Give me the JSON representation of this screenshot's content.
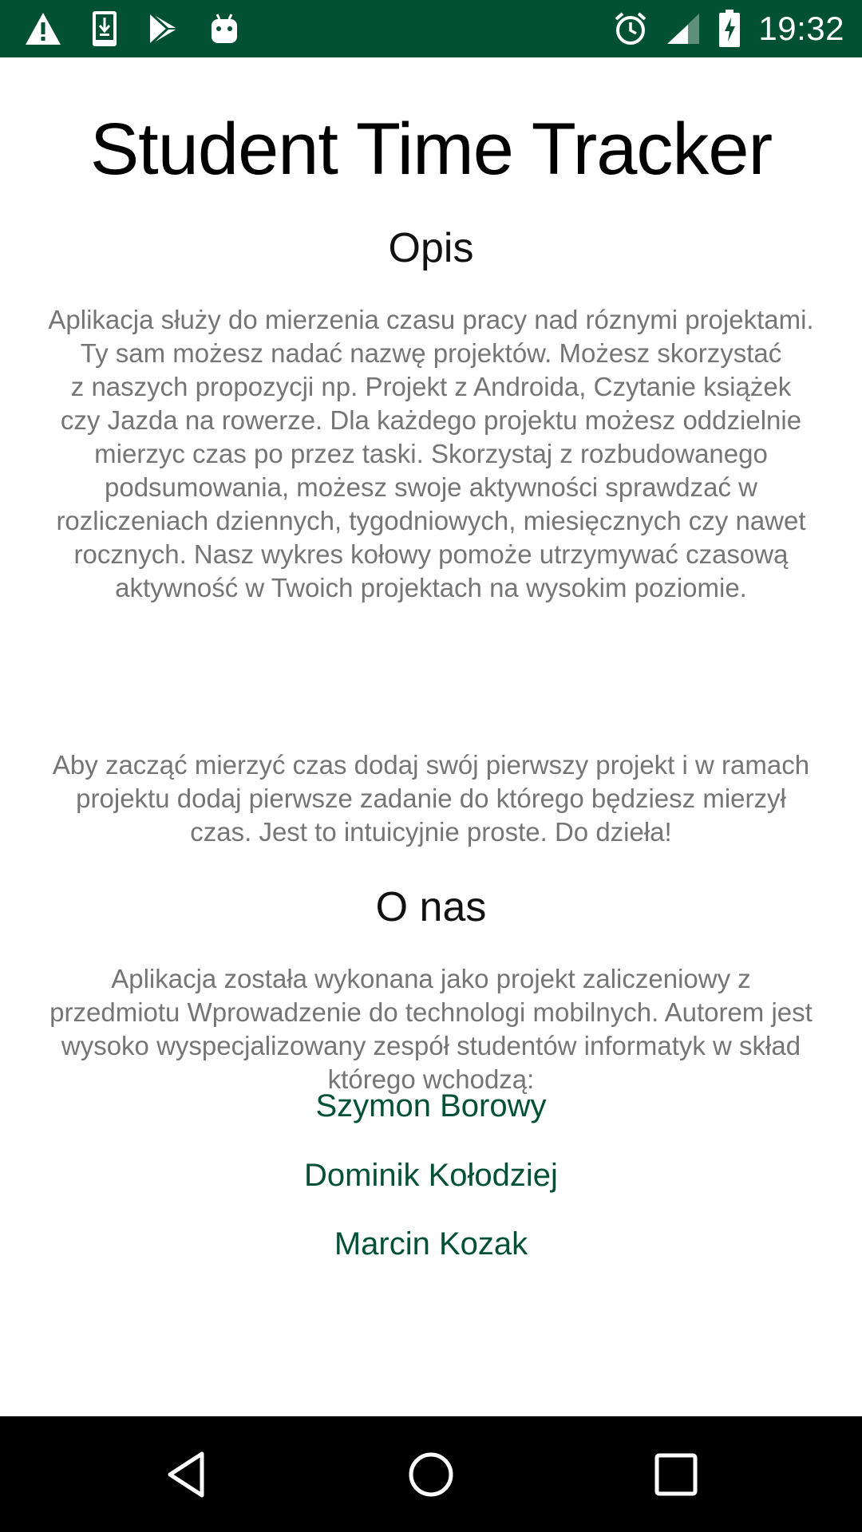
{
  "status_bar": {
    "time": "19:32",
    "left_icons": [
      "warning-icon",
      "download-icon",
      "play-store-icon",
      "android-icon"
    ],
    "right_icons": [
      "alarm-icon",
      "signal-icon",
      "battery-charging-icon"
    ],
    "background": "#025135"
  },
  "app": {
    "title": "Student Time Tracker"
  },
  "description": {
    "heading": "Opis",
    "lines": [
      "Aplikacja służy do mierzenia czasu pracy nad róznymi projektami.",
      "Ty sam możesz nadać nazwę projektów. Możesz skorzystać",
      "z naszych propozycji np. Projekt z Androida, Czytanie książek",
      "czy Jazda na rowerze. Dla każdego projektu możesz oddzielnie",
      "mierzyc czas po przez taski. Skorzystaj z rozbudowanego",
      "podsumowania, możesz swoje aktywności sprawdzać w",
      "rozliczeniach dziennych, tygodniowych, miesięcznych czy nawet",
      "rocznych. Nasz wykres kołowy pomoże utrzymywać czasową",
      "aktywność w Twoich projektach na wysokim poziomie."
    ],
    "start_lines": [
      "Aby zacząć mierzyć czas dodaj swój pierwszy projekt i w ramach",
      "projektu dodaj pierwsze zadanie do którego będziesz mierzył",
      "czas. Jest to intuicyjnie proste. Do dzieła!"
    ]
  },
  "about": {
    "heading": "O nas",
    "lines": [
      "Aplikacja została wykonana jako projekt zaliczeniowy z",
      "przedmiotu Wprowadzenie do technologi mobilnych. Autorem jest",
      "wysoko wyspecjalizowany zespół studentów informatyk w skład",
      "którego wchodzą:"
    ],
    "authors": [
      "Szymon Borowy",
      "Dominik Kołodziej",
      "Marcin Kozak"
    ]
  },
  "colors": {
    "accent": "#025135",
    "body_text": "#757575"
  },
  "nav_bar": {
    "buttons": [
      "back-icon",
      "home-icon",
      "recents-icon"
    ]
  }
}
